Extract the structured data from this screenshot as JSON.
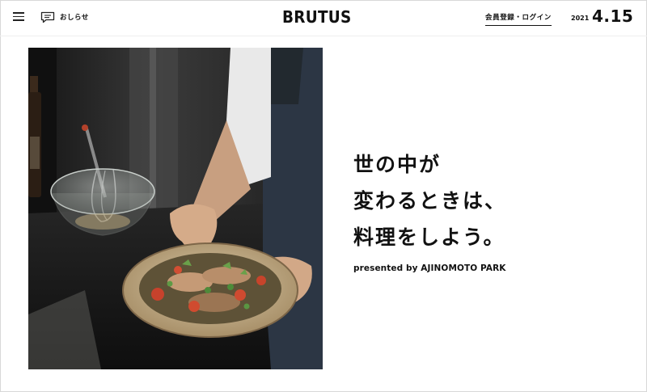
{
  "header": {
    "notice_label": "おしらせ",
    "logo_text": "BRUTUS",
    "login_label": "会員登録・ログイン",
    "year": "2021",
    "date": "4.15"
  },
  "hero": {
    "headline_lines": [
      "世の中が",
      "変わるときは、",
      "料理をしよう。"
    ],
    "presented": "presented by AJINOMOTO PARK"
  },
  "icons": {
    "menu": "hamburger-menu-icon",
    "notice": "speech-bubble-icon"
  }
}
